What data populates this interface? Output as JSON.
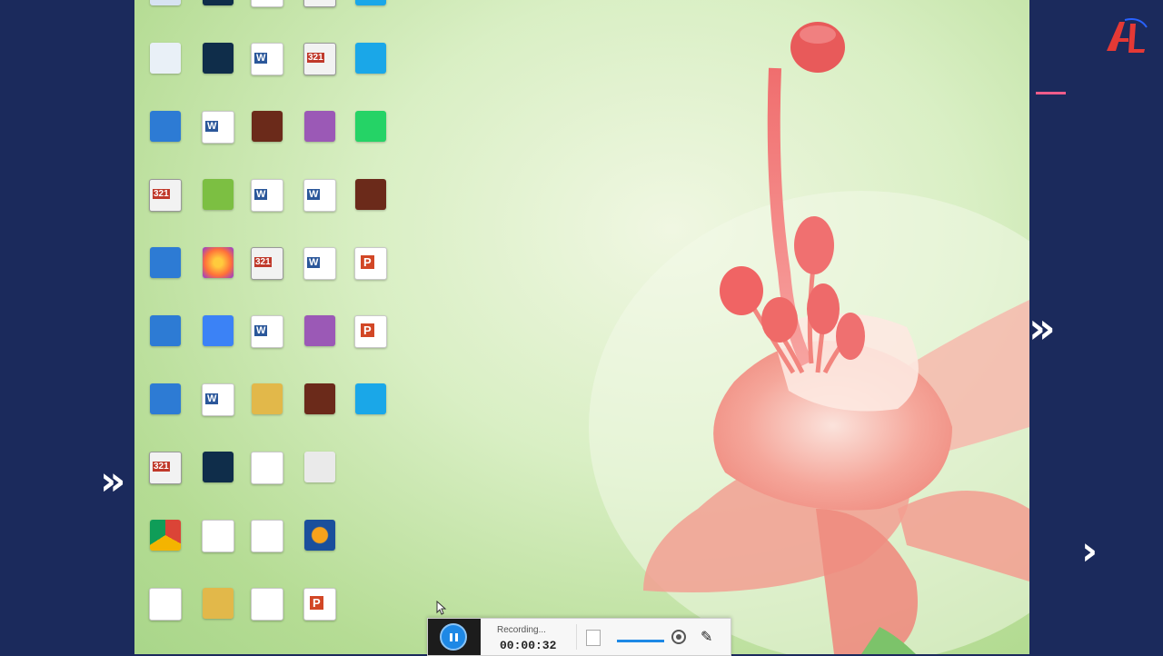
{
  "brand": {
    "logo_text": "AI",
    "accent_color": "#ef5c8a",
    "panel_color": "#1b2a5c"
  },
  "navigation": {
    "left_arrow": "»",
    "right_arrow_double": "»",
    "right_arrow_single": "›"
  },
  "desktop": {
    "wallpaper": "pink-lily-flower",
    "icons": [
      {
        "label": "",
        "kind": "system",
        "icon": "this-pc-icon"
      },
      {
        "label": "",
        "kind": "app",
        "icon": "app-icon"
      },
      {
        "label": "",
        "kind": "doc",
        "icon": "word-doc-icon"
      },
      {
        "label": "",
        "kind": "media",
        "icon": "media-player-icon"
      },
      {
        "label": "",
        "kind": "app",
        "icon": "app-icon"
      },
      {
        "label": "",
        "kind": "recycle",
        "icon": "recycle-bin-icon"
      },
      {
        "label": "",
        "kind": "app",
        "icon": "filmora-icon"
      },
      {
        "label": "",
        "kind": "doc",
        "icon": "word-doc-icon"
      },
      {
        "label": "",
        "kind": "media",
        "icon": "media-player-icon"
      },
      {
        "label": "",
        "kind": "app",
        "icon": "teamviewer-icon"
      },
      {
        "label": "",
        "kind": "app",
        "icon": "screen-recorder-icon"
      },
      {
        "label": "",
        "kind": "doc",
        "icon": "word-doc-icon"
      },
      {
        "label": "",
        "kind": "photo",
        "icon": "photo-icon"
      },
      {
        "label": "",
        "kind": "app",
        "icon": "audio-editor-icon"
      },
      {
        "label": "",
        "kind": "app",
        "icon": "whatsapp-icon"
      },
      {
        "label": "",
        "kind": "media",
        "icon": "media-player-icon"
      },
      {
        "label": "",
        "kind": "app",
        "icon": "utorrent-icon"
      },
      {
        "label": "",
        "kind": "doc",
        "icon": "word-doc-icon"
      },
      {
        "label": "",
        "kind": "doc",
        "icon": "word-doc-icon"
      },
      {
        "label": "",
        "kind": "photo",
        "icon": "video-thumbnail-icon"
      },
      {
        "label": "",
        "kind": "app",
        "icon": "control-panel-icon"
      },
      {
        "label": "",
        "kind": "app",
        "icon": "firefox-icon"
      },
      {
        "label": "",
        "kind": "media",
        "icon": "media-player-icon"
      },
      {
        "label": "",
        "kind": "doc",
        "icon": "word-doc-icon"
      },
      {
        "label": "",
        "kind": "ppt",
        "icon": "office-icon"
      },
      {
        "label": "",
        "kind": "app",
        "icon": "keyboard-app-icon"
      },
      {
        "label": "",
        "kind": "app",
        "icon": "spell-checker-icon"
      },
      {
        "label": "",
        "kind": "doc",
        "icon": "word-doc-icon"
      },
      {
        "label": "",
        "kind": "app",
        "icon": "office-app-icon"
      },
      {
        "label": "",
        "kind": "ppt",
        "icon": "powerpoint-icon"
      },
      {
        "label": "",
        "kind": "app",
        "icon": "tools-icon"
      },
      {
        "label": "",
        "kind": "doc",
        "icon": "word-doc-icon"
      },
      {
        "label": "",
        "kind": "folder",
        "icon": "zip-folder-icon"
      },
      {
        "label": "",
        "kind": "photo",
        "icon": "video-thumbnail-icon"
      },
      {
        "label": "",
        "kind": "app",
        "icon": "app-icon"
      },
      {
        "label": "",
        "kind": "media",
        "icon": "media-player-icon"
      },
      {
        "label": "",
        "kind": "app",
        "icon": "filmora-file-icon"
      },
      {
        "label": "",
        "kind": "blank",
        "icon": "text-file-icon"
      },
      {
        "label": "",
        "kind": "phone",
        "icon": "phone-icon"
      },
      {
        "label": "",
        "kind": "none",
        "icon": ""
      },
      {
        "label": "",
        "kind": "app",
        "icon": "chrome-icon"
      },
      {
        "label": "",
        "kind": "blank",
        "icon": "text-file-icon"
      },
      {
        "label": "",
        "kind": "blank",
        "icon": "text-file-icon"
      },
      {
        "label": "",
        "kind": "app",
        "icon": "audacity-icon"
      },
      {
        "label": "",
        "kind": "none",
        "icon": ""
      },
      {
        "label": "",
        "kind": "blank",
        "icon": "text-file-icon"
      },
      {
        "label": "",
        "kind": "folder",
        "icon": "folder-icon"
      },
      {
        "label": "",
        "kind": "blank",
        "icon": "text-file-icon"
      },
      {
        "label": "",
        "kind": "ppt",
        "icon": "powerpoint-icon"
      },
      {
        "label": "",
        "kind": "none",
        "icon": ""
      }
    ]
  },
  "recording_bar": {
    "status": "Recording...",
    "timer": "00:00:32",
    "pause_color": "#1e88e5"
  }
}
